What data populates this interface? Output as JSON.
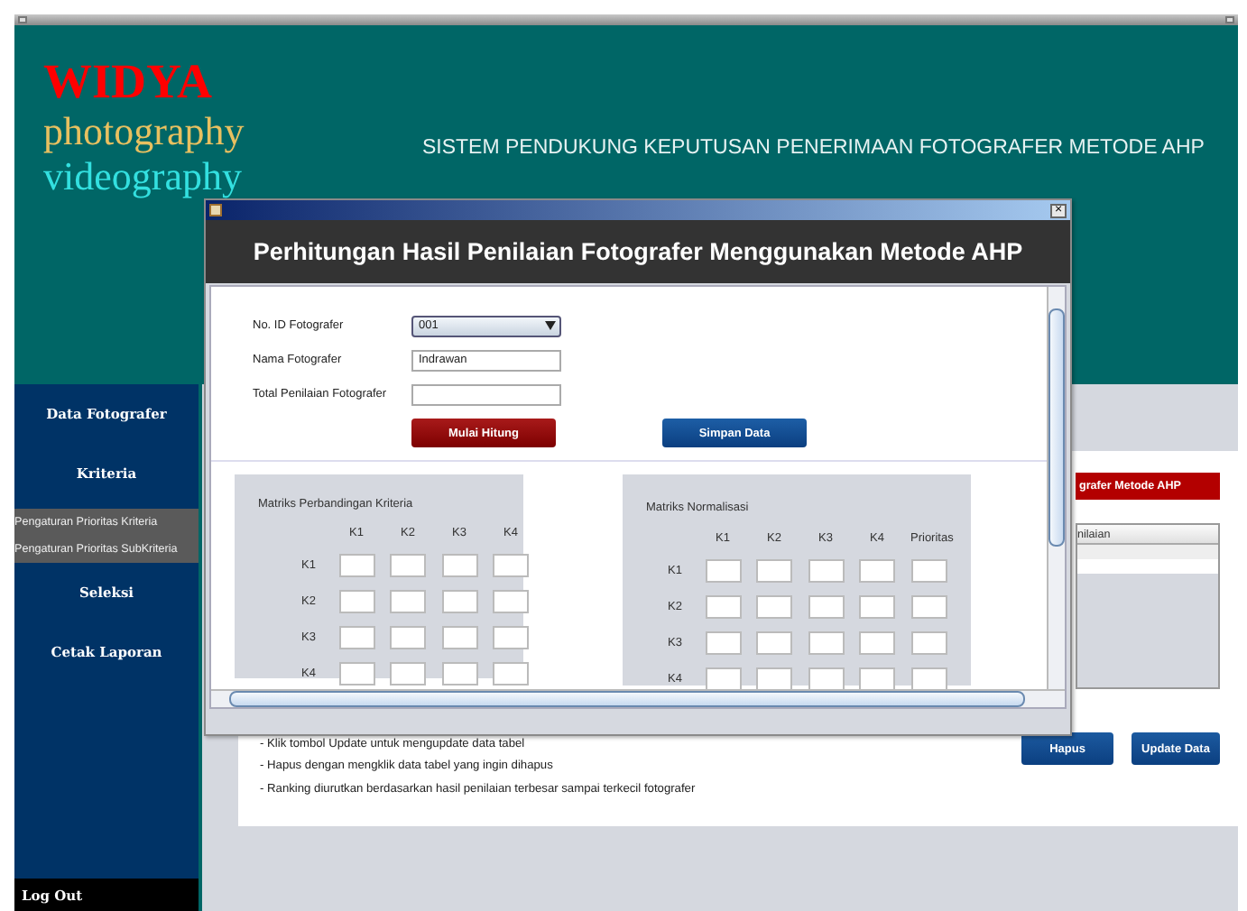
{
  "header": {
    "logo": {
      "brand": "WIDYA",
      "line_2": "photography",
      "line_3": "videography"
    },
    "title": "SISTEM PENDUKUNG KEPUTUSAN PENERIMAAN FOTOGRAFER METODE AHP"
  },
  "sidebar": {
    "items": [
      {
        "label": "Data Fotografer",
        "kind": "menu"
      },
      {
        "label": "Kriteria",
        "kind": "menu"
      },
      {
        "label": "Pengaturan Prioritas Kriteria",
        "kind": "submenu"
      },
      {
        "label": "Pengaturan Prioritas SubKriteria",
        "kind": "submenu"
      },
      {
        "label": "Seleksi",
        "kind": "menu"
      },
      {
        "label": "Cetak Laporan",
        "kind": "menu"
      }
    ],
    "logout": "Log Out"
  },
  "main": {
    "report_button": "grafer Metode AHP",
    "table": {
      "columns": [
        "nilaian"
      ]
    },
    "notes": [
      "- Klik tombol Update untuk mengupdate data tabel",
      "- Hapus dengan mengklik data tabel yang ingin dihapus",
      "- Ranking diurutkan berdasarkan hasil penilaian terbesar sampai terkecil fotografer"
    ],
    "buttons": [
      "Hapus",
      "Update Data"
    ]
  },
  "dialog": {
    "close": "×",
    "title": "Perhitungan Hasil Penilaian Fotografer Menggunakan Metode AHP",
    "fields": [
      {
        "label": "No. ID Fotografer",
        "kind": "combo",
        "value": "001"
      },
      {
        "label": "Nama Fotografer",
        "kind": "text",
        "value": "Indrawan"
      },
      {
        "label": "Total Penilaian Fotografer",
        "kind": "text"
      }
    ],
    "buttons": [
      {
        "label": "Mulai Hitung",
        "kind": "danger"
      },
      {
        "label": "Simpan Data",
        "kind": "primary"
      }
    ],
    "matrices": [
      {
        "title": "Matriks Perbandingan Kriteria",
        "columns": [
          "K1",
          "K2",
          "K3",
          "K4"
        ],
        "rows": [
          "K1",
          "K2",
          "K3",
          "K4"
        ]
      },
      {
        "title": "Matriks Normalisasi",
        "columns": [
          "K1",
          "K2",
          "K3",
          "K4",
          "Prioritas"
        ],
        "rows": [
          "K1",
          "K2",
          "K3",
          "K4"
        ]
      }
    ]
  }
}
